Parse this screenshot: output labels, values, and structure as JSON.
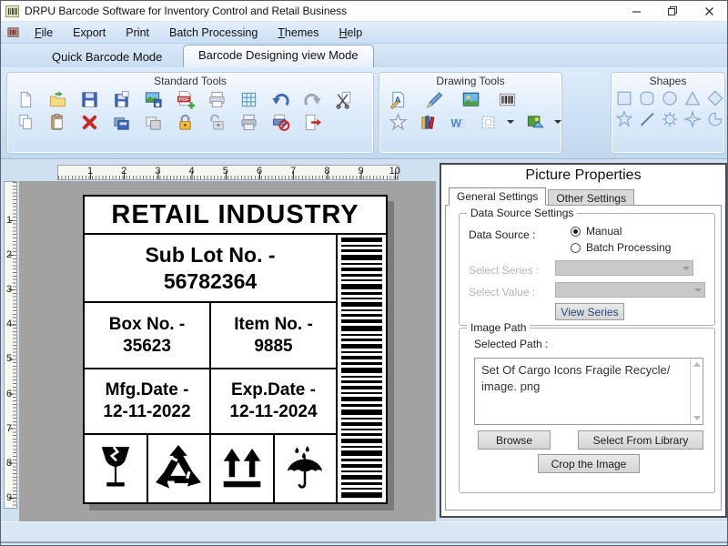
{
  "window": {
    "title": "DRPU Barcode Software for Inventory Control and Retail Business",
    "controls": [
      "minimize",
      "restore",
      "close"
    ]
  },
  "menu": {
    "items": [
      "File",
      "Export",
      "Print",
      "Batch Processing",
      "Themes",
      "Help"
    ]
  },
  "mode_tabs": {
    "inactive": "Quick Barcode Mode",
    "active": "Barcode Designing view Mode"
  },
  "toolbar": {
    "groups": [
      {
        "title": "Standard Tools",
        "icons_row1": [
          "new-document",
          "open-file",
          "save",
          "save-all",
          "save-image",
          "export-pdf",
          "print",
          "grid-view",
          "undo",
          "redo",
          "cut"
        ],
        "icons_row2": [
          "copy",
          "paste",
          "delete",
          "copy-object",
          "duplicate-object",
          "lock",
          "unlock",
          "print-preview",
          "cancel-print",
          "exit"
        ]
      },
      {
        "title": "Drawing Tools",
        "icons_row1": [
          "add-text",
          "pencil",
          "add-picture",
          "add-barcode"
        ],
        "icons_row2": [
          "add-shape",
          "library",
          "watermark",
          "frame",
          "image-gallery"
        ]
      },
      {
        "title": "Shapes",
        "icons_row1": [
          "rectangle",
          "rounded-rectangle",
          "ellipse",
          "triangle",
          "diamond"
        ],
        "icons_row2": [
          "star",
          "line",
          "seal",
          "four-point-star",
          "pie"
        ]
      }
    ]
  },
  "rulers": {
    "horizontal": [
      "1",
      "2",
      "3",
      "4",
      "5",
      "6",
      "7",
      "8",
      "9",
      "10"
    ],
    "vertical": [
      "1",
      "2",
      "3",
      "4",
      "5",
      "6",
      "7",
      "8",
      "9"
    ]
  },
  "label": {
    "title": "RETAIL INDUSTRY",
    "sub_lot": {
      "line1": "Sub Lot No. -",
      "line2": "56782364"
    },
    "box_no": {
      "line1": "Box No. -",
      "line2": "35623"
    },
    "item_no": {
      "line1": "Item No. -",
      "line2": "9885"
    },
    "mfg_date": {
      "line1": "Mfg.Date -",
      "line2": "12-11-2022"
    },
    "exp_date": {
      "line1": "Exp.Date -",
      "line2": "12-11-2024"
    },
    "icons": [
      "fragile-icon",
      "recycle-icon",
      "this-side-up-icon",
      "keep-dry-icon"
    ],
    "barcode_pattern": [
      5,
      2,
      3,
      6,
      2,
      4,
      3,
      2,
      6,
      3,
      2,
      5,
      2,
      3,
      4,
      6,
      2,
      3,
      5,
      2,
      4,
      3,
      6,
      2,
      3,
      4,
      2,
      5,
      3,
      6,
      2,
      4,
      2,
      3,
      5,
      2,
      6,
      3,
      4,
      2,
      5,
      3,
      2,
      6
    ]
  },
  "properties_panel": {
    "title": "Picture Properties",
    "tabs": {
      "active": "General Settings",
      "inactive": "Other Settings"
    },
    "data_source_settings": {
      "legend": "Data Source Settings",
      "data_source_label": "Data Source :",
      "options": [
        {
          "label": "Manual",
          "selected": true
        },
        {
          "label": "Batch Processing",
          "selected": false
        }
      ],
      "select_series_label": "Select Series :",
      "select_value_label": "Select Value :",
      "view_series_button": "View Series"
    },
    "image_path": {
      "legend": "Image Path",
      "selected_path_label": "Selected Path :",
      "path_text": "Set Of Cargo Icons Fragile Recycle/ image. png",
      "browse_button": "Browse",
      "library_button": "Select From Library",
      "crop_button": "Crop the Image"
    }
  },
  "colors": {
    "accent_blue": "#3f66ba",
    "toolbar_bg": "#d6e6f6",
    "canvas_gray": "#a2a2a2",
    "status_bar": "#d9e7f4",
    "label_border": "#000000"
  }
}
